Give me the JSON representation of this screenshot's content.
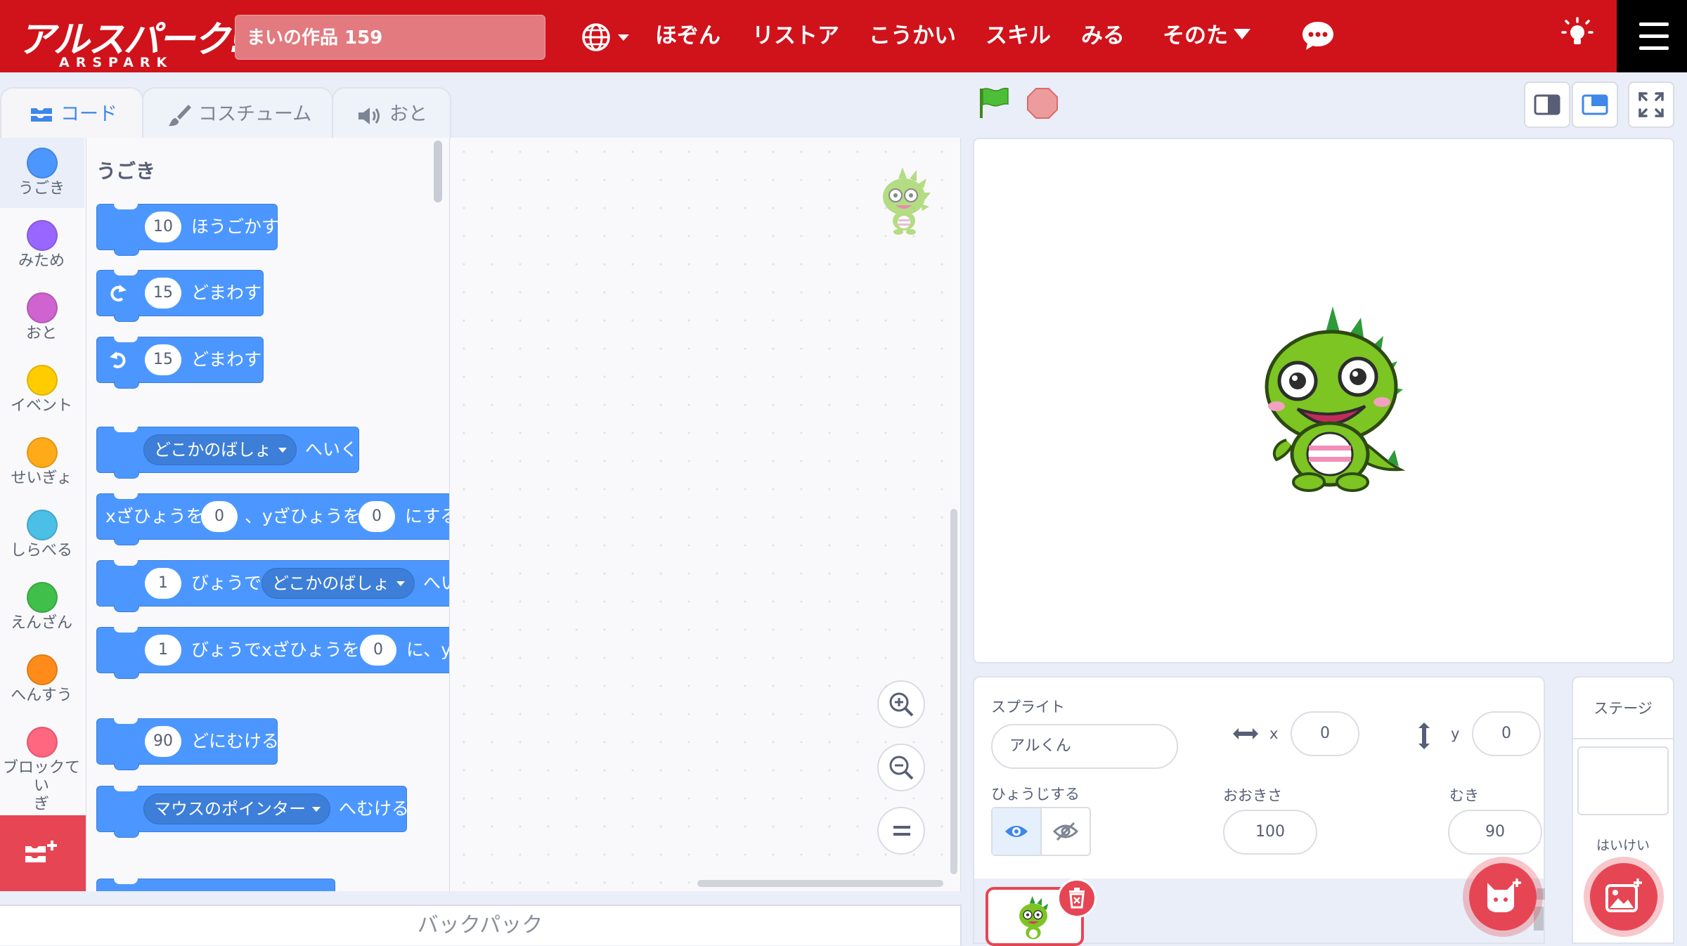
{
  "menubar": {
    "logo_text": "アルスパーク!",
    "logo_sub": "ARSPARK",
    "project_title": "まいの作品 159",
    "items": [
      "ほぞん",
      "リストア",
      "こうかい",
      "スキル",
      "みる",
      "そのた"
    ]
  },
  "tabs": {
    "code": "コード",
    "costume": "コスチューム",
    "sound": "おと"
  },
  "categories": [
    {
      "label": "うごき",
      "color": "#4c97ff"
    },
    {
      "label": "みため",
      "color": "#9966ff"
    },
    {
      "label": "おと",
      "color": "#cf63cf"
    },
    {
      "label": "イベント",
      "color": "#ffcc00"
    },
    {
      "label": "せいぎょ",
      "color": "#ffab19"
    },
    {
      "label": "しらべる",
      "color": "#4cbfe6"
    },
    {
      "label": "えんざん",
      "color": "#40bf4a"
    },
    {
      "label": "へんすう",
      "color": "#ff8c1a"
    },
    {
      "label": "ブロックてい\nぎ",
      "color": "#ff6680"
    }
  ],
  "flyout": {
    "section_title": "うごき",
    "b_move": {
      "value": "10",
      "text": "ほうごかす"
    },
    "b_turn_right": {
      "value": "15",
      "text": "どまわす"
    },
    "b_turn_left": {
      "value": "15",
      "text": "どまわす"
    },
    "b_goto": {
      "dropdown": "どこかのばしょ",
      "text": "へいく"
    },
    "b_gotoxy": {
      "t1": "xざひょうを",
      "x": "0",
      "t2": "、yざひょうを",
      "y": "0",
      "t3": "にする"
    },
    "b_glide": {
      "secs": "1",
      "t1": "びょうで",
      "dropdown": "どこかのばしょ",
      "t2": "へい"
    },
    "b_glidexy": {
      "secs": "1",
      "t1": "びょうでxざひょうを",
      "x": "0",
      "t2": "に、yざ"
    },
    "b_point": {
      "value": "90",
      "text": "どにむける"
    },
    "b_pointtowards": {
      "dropdown": "マウスのポインター",
      "text": "へむける"
    }
  },
  "backpack_label": "バックパック",
  "sprite_info": {
    "sprite_label": "スプライト",
    "sprite_name": "アルくん",
    "x_label": "x",
    "x_value": "0",
    "y_label": "y",
    "y_value": "0",
    "show_label": "ひょうじする",
    "size_label": "おおきさ",
    "size_value": "100",
    "direction_label": "むき",
    "direction_value": "90"
  },
  "stage_pane": {
    "title": "ステージ",
    "backdrop_label": "はいけい"
  },
  "colors": {
    "brand_red": "#d0121b",
    "motion_blue": "#4c97ff",
    "accent_blue": "#3f87e8",
    "dino_green": "#7cc522"
  }
}
